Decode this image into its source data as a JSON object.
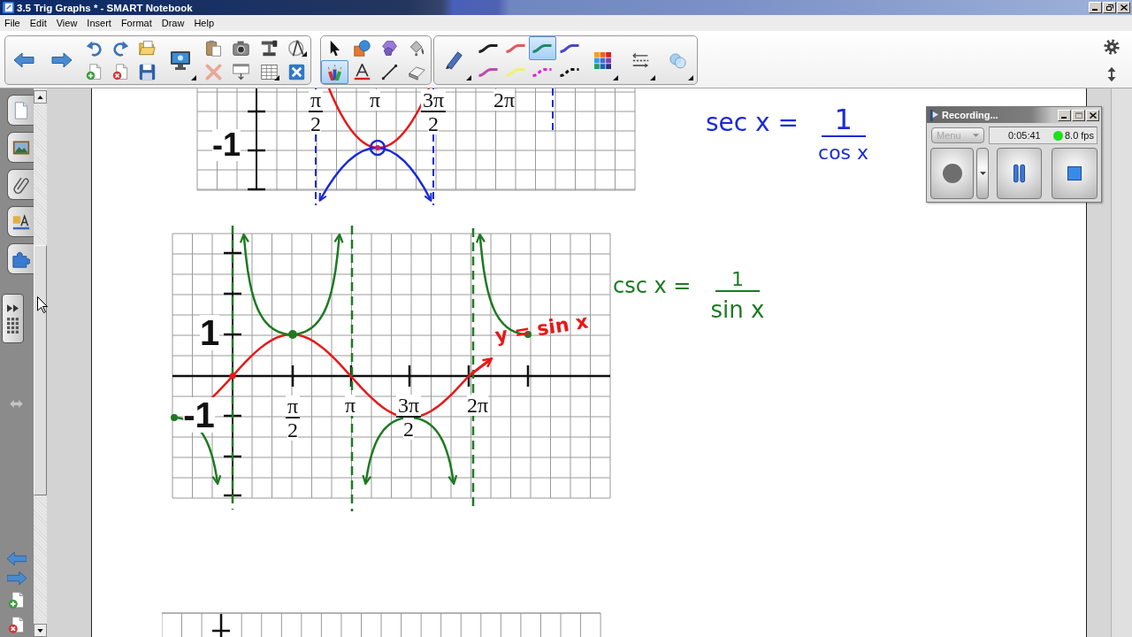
{
  "window": {
    "title": "3.5 Trig Graphs * - SMART Notebook"
  },
  "menu": [
    "File",
    "Edit",
    "View",
    "Insert",
    "Format",
    "Draw",
    "Help"
  ],
  "toolbar": {
    "tools": [
      {
        "kind": "select",
        "selected": false
      },
      {
        "kind": "shapes",
        "selected": false
      },
      {
        "kind": "polygons",
        "selected": false
      },
      {
        "kind": "fill",
        "selected": false
      },
      {
        "kind": "pens",
        "selected": true
      },
      {
        "kind": "text",
        "selected": false
      },
      {
        "kind": "line",
        "selected": false
      },
      {
        "kind": "eraser",
        "selected": false
      }
    ],
    "pen_styles": [
      {
        "color": "#222222",
        "dashed": false,
        "selected": false
      },
      {
        "color": "#e05a5a",
        "dashed": false,
        "selected": false
      },
      {
        "color": "#1f8a6a",
        "dashed": false,
        "selected": true
      },
      {
        "color": "#4848c8",
        "dashed": false,
        "selected": false
      },
      {
        "color": "#c04aa8",
        "dashed": false,
        "selected": false
      },
      {
        "color": "#eef07a",
        "dashed": false,
        "selected": false
      },
      {
        "color": "#e020d0",
        "dashed": true,
        "selected": false
      },
      {
        "color": "#111111",
        "dashed": true,
        "selected": false
      }
    ]
  },
  "recorder": {
    "title": "Recording...",
    "menu": {
      "label": "Menu",
      "disabled": true
    },
    "elapsed": "0:05:41",
    "frame_rate": "8.0 fps"
  },
  "page": {
    "graphs": [
      {
        "labels": [
          {
            "kind": "fraction",
            "numerator": "π",
            "denominator": "2"
          },
          {
            "kind": "plain",
            "text": "π"
          },
          {
            "kind": "fraction",
            "numerator": "3π",
            "denominator": "2"
          },
          {
            "kind": "plain",
            "text": "2π"
          },
          {
            "kind": "plain",
            "text": "-1"
          }
        ]
      },
      {
        "labels": [
          {
            "kind": "plain",
            "text": "1"
          },
          {
            "kind": "plain",
            "text": "-1"
          },
          {
            "kind": "fraction",
            "numerator": "π",
            "denominator": "2"
          },
          {
            "kind": "plain",
            "text": "π"
          },
          {
            "kind": "fraction",
            "numerator": "3π",
            "denominator": "2"
          },
          {
            "kind": "plain",
            "text": "2π"
          }
        ]
      }
    ],
    "notes": [
      {
        "kind": "fraction",
        "color": "#1a2ad8",
        "lhs": "sec x =",
        "numerator": "1",
        "denominator": "cos x"
      },
      {
        "kind": "fraction",
        "color": "#1e7a22",
        "lhs": "csc x =",
        "numerator": "1",
        "denominator": "sin x"
      },
      {
        "kind": "plain",
        "color": "#e81818",
        "text": "y = sin x"
      }
    ]
  }
}
